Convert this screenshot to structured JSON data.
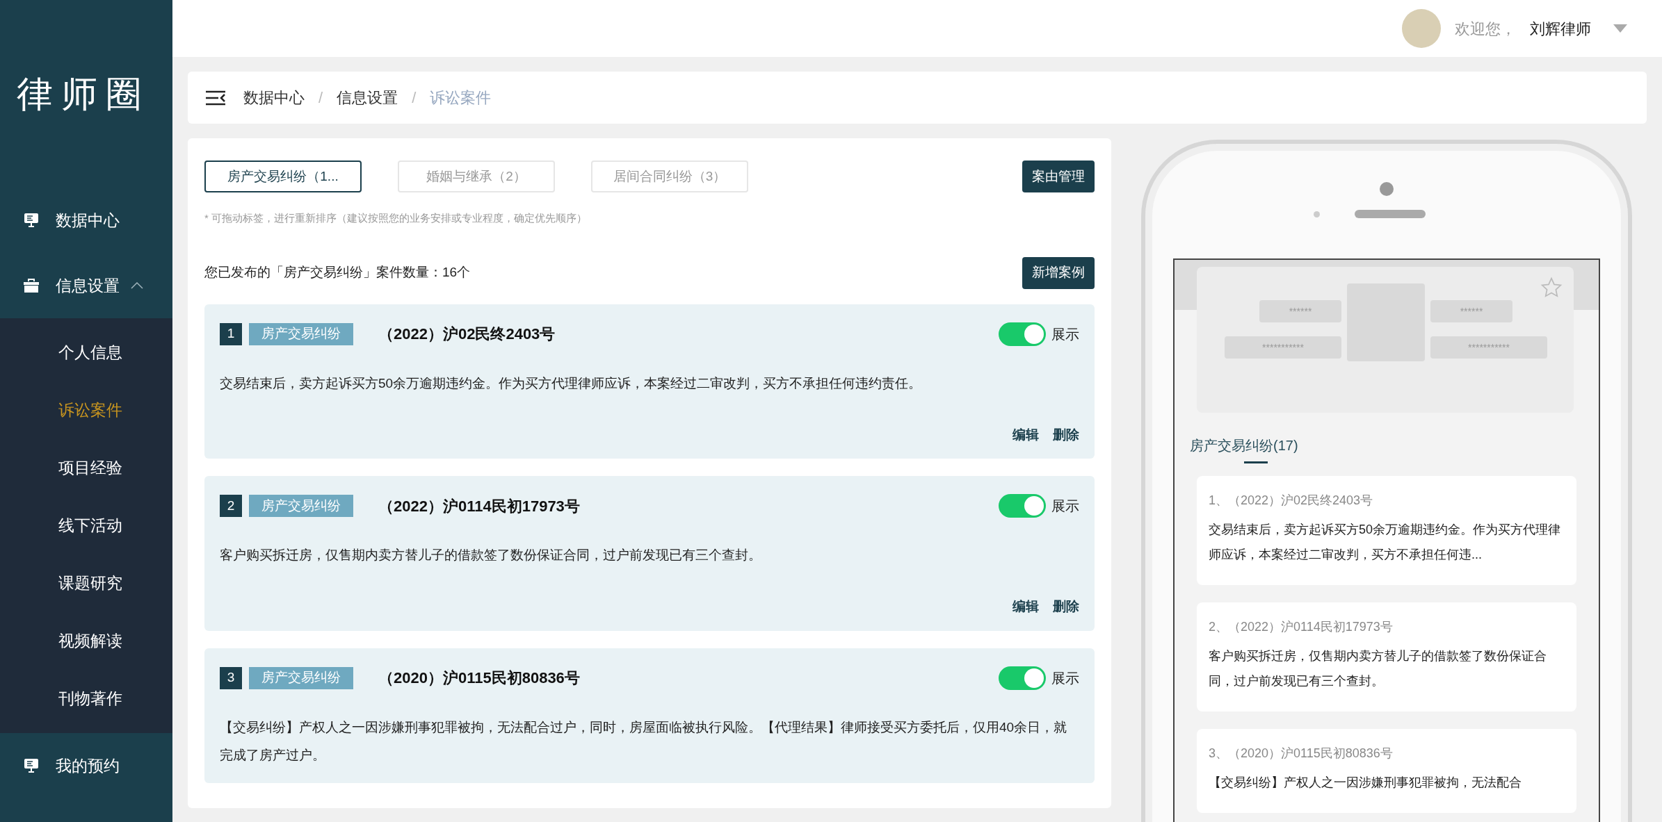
{
  "sidebar": {
    "logo": "律师圈",
    "items": [
      {
        "kind": "link",
        "label": "数据中心"
      },
      {
        "kind": "group",
        "label": "信息设置",
        "expanded": true,
        "children": [
          {
            "label": "个人信息",
            "selected": false
          },
          {
            "label": "诉讼案件",
            "selected": true
          },
          {
            "label": "项目经验",
            "selected": false
          },
          {
            "label": "线下活动",
            "selected": false
          },
          {
            "label": "课题研究",
            "selected": false
          },
          {
            "label": "视频解读",
            "selected": false
          },
          {
            "label": "刊物著作",
            "selected": false
          }
        ]
      },
      {
        "kind": "link",
        "label": "我的预约"
      }
    ]
  },
  "header": {
    "greeting": "欢迎您，",
    "user_name": "刘辉律师"
  },
  "breadcrumb": [
    {
      "kind": "link",
      "label": "数据中心",
      "current": false
    },
    {
      "kind": "separator",
      "label": "/"
    },
    {
      "kind": "link",
      "label": "信息设置",
      "current": false
    },
    {
      "kind": "separator",
      "label": "/"
    },
    {
      "kind": "link",
      "label": "诉讼案件",
      "current": true
    }
  ],
  "category_tabs": [
    {
      "label": "房产交易纠纷（1...",
      "selected": true
    },
    {
      "label": "婚姻与继承（2）",
      "selected": false
    },
    {
      "label": "居间合同纠纷（3）",
      "selected": false
    }
  ],
  "manage_button": "案由管理",
  "hint": "* 可拖动标签，进行重新排序（建议按照您的业务安排或专业程度，确定优先顺序）",
  "summary": "您已发布的「房产交易纠纷」案件数量：16个",
  "add_button": "新增案例",
  "cases": [
    {
      "index": "1",
      "tag": "房产交易纠纷",
      "title": "（2022）沪02民终2403号",
      "shown": true,
      "toggle_label": "展示",
      "description": "交易结束后，卖方起诉买方50余万逾期违约金。作为买方代理律师应诉，本案经过二审改判，买方不承担任何违约责任。",
      "actions": [
        "编辑",
        "删除"
      ]
    },
    {
      "index": "2",
      "tag": "房产交易纠纷",
      "title": "（2022）沪0114民初17973号",
      "shown": true,
      "toggle_label": "展示",
      "description": "客户购买拆迁房，仅售期内卖方替儿子的借款签了数份保证合同，过户前发现已有三个查封。",
      "actions": [
        "编辑",
        "删除"
      ]
    },
    {
      "index": "3",
      "tag": "房产交易纠纷",
      "title": "（2020）沪0115民初80836号",
      "shown": true,
      "toggle_label": "展示",
      "description": "【交易纠纷】产权人之一因涉嫌刑事犯罪被拘，无法配合过户，同时，房屋面临被执行风险。【代理结果】律师接受买方委托后，仅用40余日，就完成了房产过户。"
    }
  ],
  "preview": {
    "left_tags": [
      "******",
      "***********"
    ],
    "right_tags": [
      "******",
      "***********"
    ],
    "tab": "房产交易纠纷(17)",
    "cases": [
      {
        "heading": "1、（2022）沪02民终2403号",
        "text": "交易结束后，卖方起诉买方50余万逾期违约金。作为买方代理律师应诉，本案经过二审改判，买方不承担任何违..."
      },
      {
        "heading": "2、（2022）沪0114民初17973号",
        "text": "客户购买拆迁房，仅售期内卖方替儿子的借款签了数份保证合同，过户前发现已有三个查封。"
      },
      {
        "heading": "3、（2020）沪0115民初80836号",
        "text": "【交易纠纷】产权人之一因涉嫌刑事犯罪被拘，无法配合"
      }
    ]
  }
}
